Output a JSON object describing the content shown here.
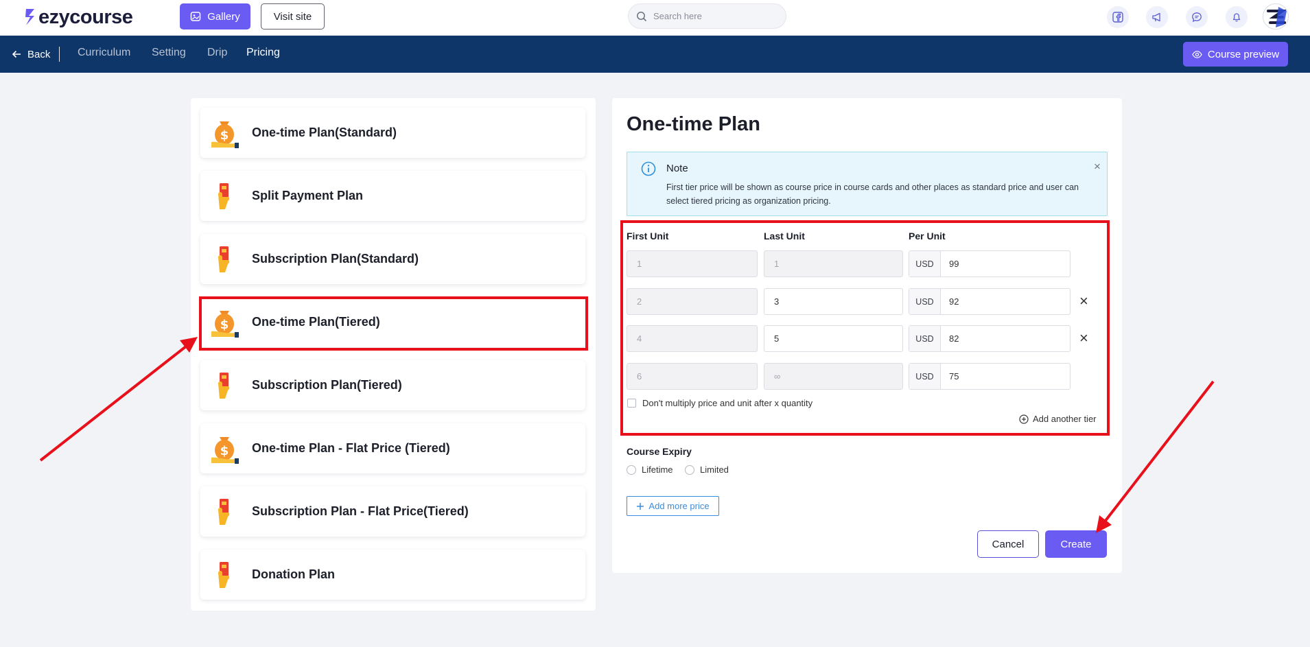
{
  "header": {
    "logo_text": "ezycourse",
    "gallery_label": "Gallery",
    "visit_site_label": "Visit site",
    "search_placeholder": "Search here",
    "icons": [
      "facebook-icon",
      "megaphone-icon",
      "chat-icon",
      "bell-icon"
    ]
  },
  "nav": {
    "back_label": "Back",
    "tabs": [
      {
        "label": "Curriculum",
        "active": false
      },
      {
        "label": "Setting",
        "active": false
      },
      {
        "label": "Drip",
        "active": false
      },
      {
        "label": "Pricing",
        "active": true
      }
    ],
    "course_preview_label": "Course preview"
  },
  "plans": [
    {
      "label": "One-time Plan(Standard)",
      "icon": "money-bag-icon"
    },
    {
      "label": "Split Payment Plan",
      "icon": "card-hand-icon"
    },
    {
      "label": "Subscription Plan(Standard)",
      "icon": "card-hand-icon"
    },
    {
      "label": "One-time Plan(Tiered)",
      "icon": "money-bag-icon",
      "selected": true
    },
    {
      "label": "Subscription Plan(Tiered)",
      "icon": "card-hand-icon"
    },
    {
      "label": "One-time Plan - Flat Price (Tiered)",
      "icon": "money-bag-icon"
    },
    {
      "label": "Subscription Plan - Flat Price(Tiered)",
      "icon": "card-hand-icon"
    },
    {
      "label": "Donation Plan",
      "icon": "card-hand-icon"
    }
  ],
  "form": {
    "title": "One-time Plan",
    "note": {
      "title": "Note",
      "text": "First tier price will be shown as course price in course cards and other places as standard price and user can select tiered pricing as organization pricing."
    },
    "columns": {
      "first": "First Unit",
      "last": "Last Unit",
      "per": "Per Unit"
    },
    "currency": "USD",
    "tiers": [
      {
        "first": "1",
        "last": "1",
        "price": "99"
      },
      {
        "first": "2",
        "last": "3",
        "price": "92"
      },
      {
        "first": "4",
        "last": "5",
        "price": "82"
      },
      {
        "first": "6",
        "last": "∞",
        "price": "75"
      }
    ],
    "no_multiply_label": "Don't multiply price and unit after x quantity",
    "add_tier_label": "Add another tier",
    "expiry": {
      "title": "Course Expiry",
      "lifetime_label": "Lifetime",
      "limited_label": "Limited"
    },
    "add_more_price_label": "Add more price",
    "cancel_label": "Cancel",
    "create_label": "Create"
  },
  "colors": {
    "accent": "#6a5cf2",
    "nav_bg": "#0f3668",
    "annotation": "#e8101b"
  }
}
